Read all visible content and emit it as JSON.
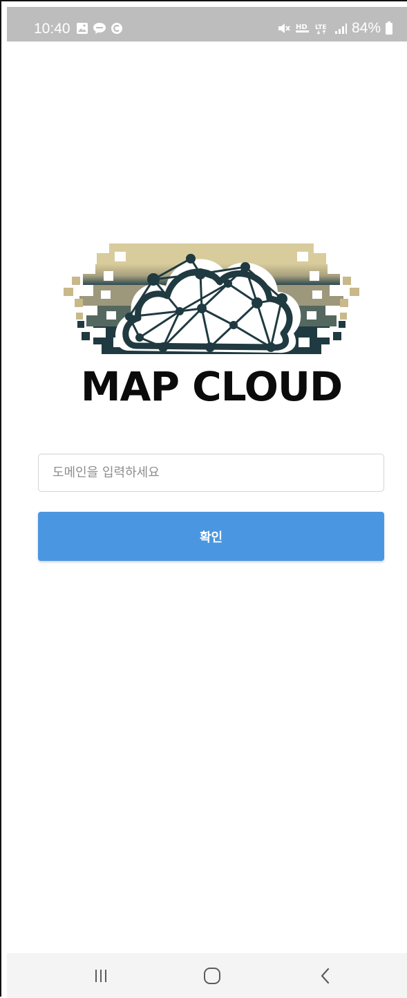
{
  "status_bar": {
    "time": "10:40",
    "battery": "84%",
    "left_icons": [
      "gallery-icon",
      "chat-talk-icon",
      "c-circle-icon"
    ],
    "right_icons": [
      "mute-icon",
      "hd-voice-icon",
      "lte-icon",
      "signal-icon",
      "battery-icon"
    ]
  },
  "logo": {
    "text": "MAP CLOUD",
    "colors": {
      "gold": "#c9b98a",
      "dark": "#1f3a40",
      "text": "#0b0b0b"
    }
  },
  "domain_input": {
    "placeholder": "도메인을 입력하세요",
    "value": ""
  },
  "confirm_button": {
    "label": "확인",
    "color": "#4b96e1"
  },
  "nav_bar": {
    "buttons": [
      "recent-apps-icon",
      "home-icon",
      "back-icon"
    ]
  }
}
